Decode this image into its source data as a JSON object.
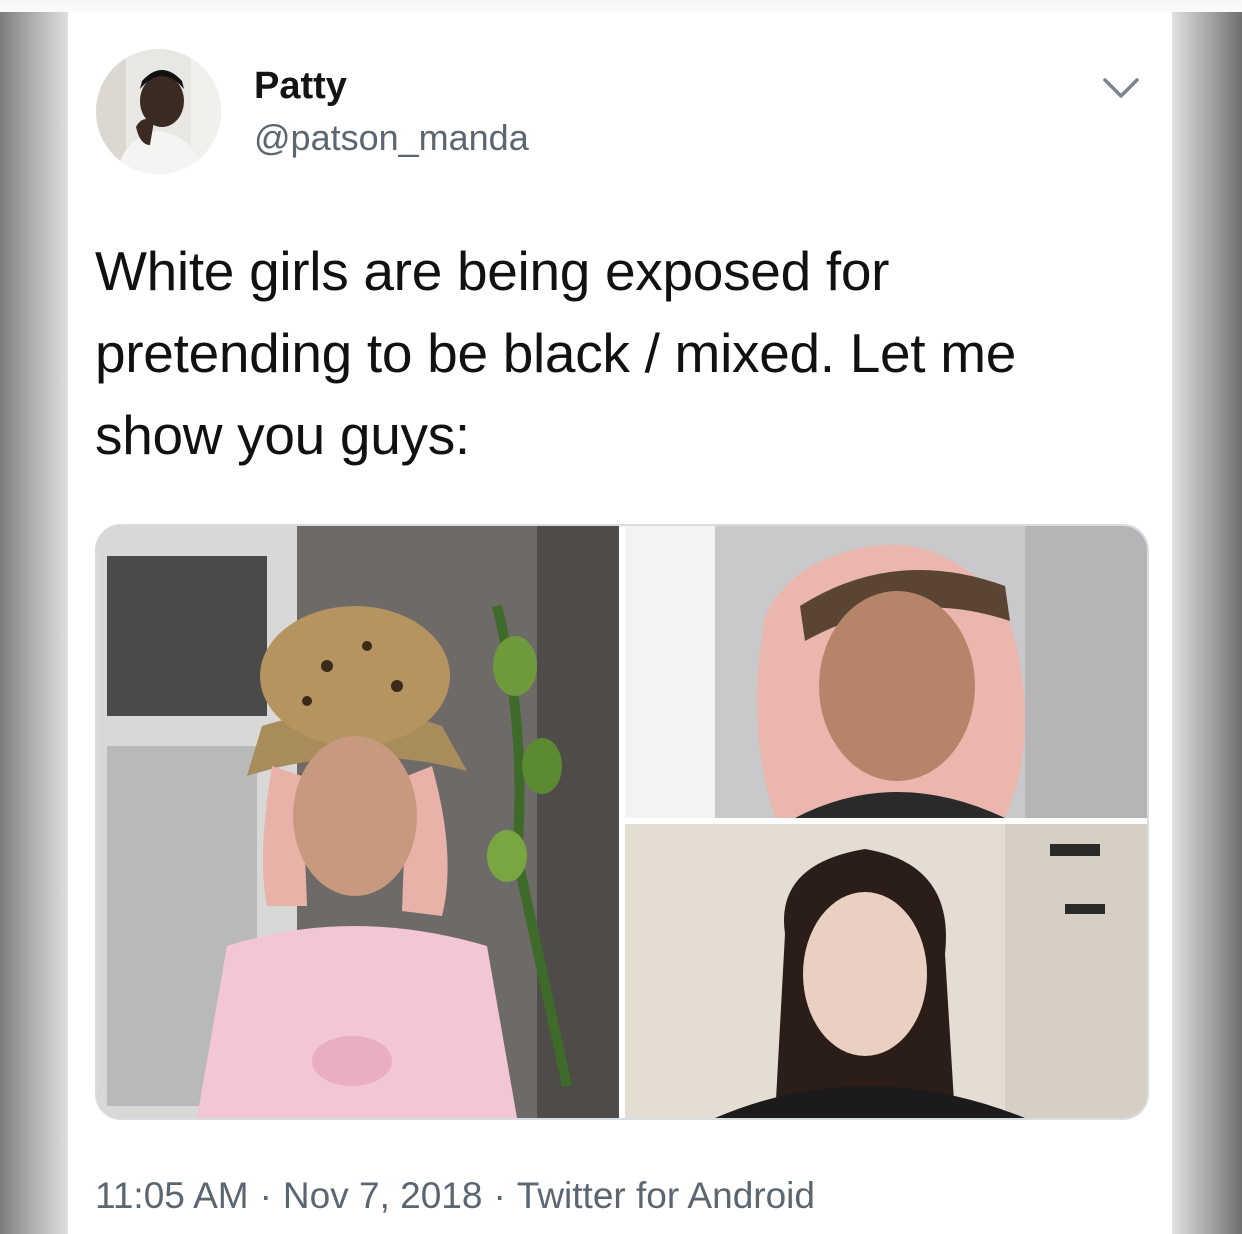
{
  "tweet": {
    "author_name": "Patty",
    "author_handle": "@patson_manda",
    "text": "White girls are being exposed for pretending to be black / mixed. Let me show you guys:",
    "time": "11:05 AM",
    "date": "Nov 7, 2018",
    "source": "Twitter for Android",
    "separator": "·"
  },
  "icons": {
    "menu": "chevron-down-icon"
  },
  "colors": {
    "text_primary": "#141414",
    "text_secondary": "#5a6671",
    "card_background": "#ffffff",
    "media_border": "#d8dde2"
  }
}
